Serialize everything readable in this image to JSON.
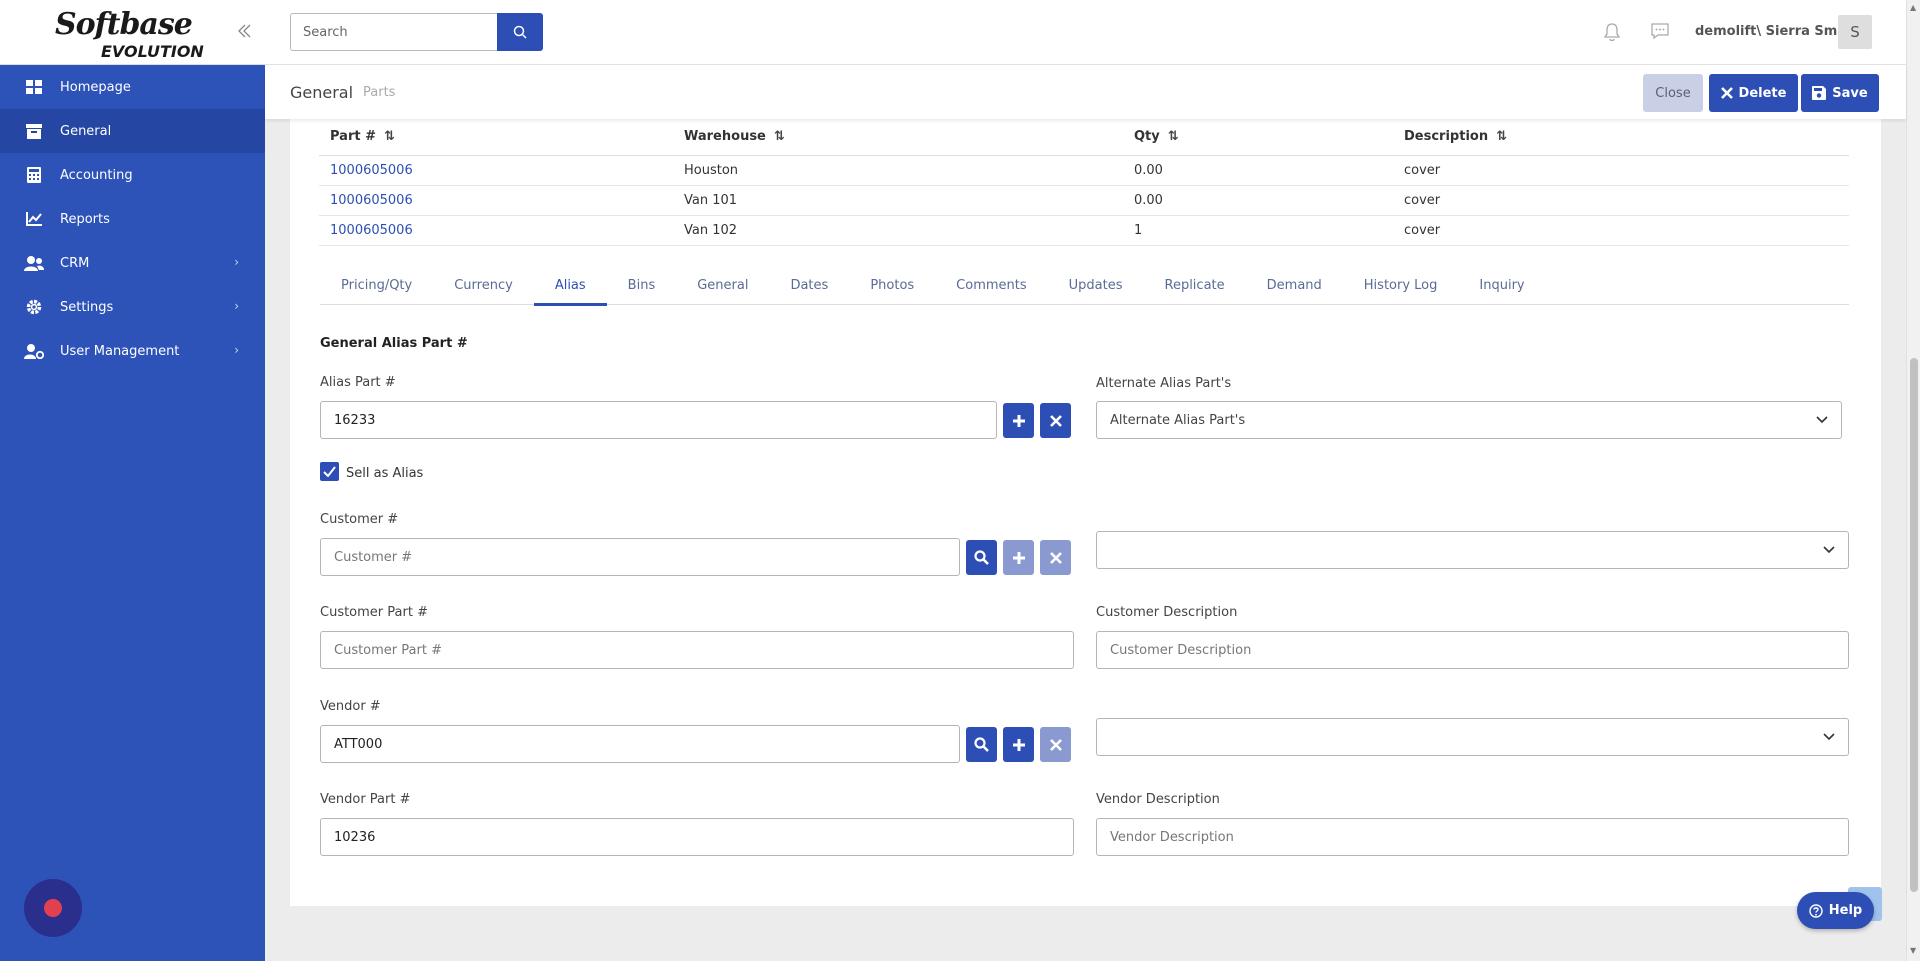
{
  "app": {
    "logo_text": "Softbase",
    "logo_sub": "EVOLUTION"
  },
  "sidebar": {
    "items": [
      {
        "label": "Homepage",
        "icon": "dashboard-icon"
      },
      {
        "label": "General",
        "icon": "archive-box-icon",
        "active": true
      },
      {
        "label": "Accounting",
        "icon": "calculator-icon"
      },
      {
        "label": "Reports",
        "icon": "chart-line-icon"
      },
      {
        "label": "CRM",
        "icon": "users-icon",
        "has_children": true
      },
      {
        "label": "Settings",
        "icon": "gear-icon",
        "has_children": true
      },
      {
        "label": "User Management",
        "icon": "user-gear-icon",
        "has_children": true
      }
    ]
  },
  "topbar": {
    "search_placeholder": "Search",
    "user_name": "demolift\\ Sierra Smith",
    "avatar_initial": "S"
  },
  "header": {
    "breadcrumb_main": "General",
    "breadcrumb_sub": "Parts",
    "close_label": "Close",
    "delete_label": "Delete",
    "save_label": "Save"
  },
  "grid": {
    "columns": [
      "Part #",
      "Warehouse",
      "Qty",
      "Description"
    ],
    "rows": [
      [
        "1000605006",
        "Houston",
        "0.00",
        "cover"
      ],
      [
        "1000605006",
        "Van 101",
        "0.00",
        "cover"
      ],
      [
        "1000605006",
        "Van 102",
        "1",
        "cover"
      ]
    ]
  },
  "tabs": [
    "Pricing/Qty",
    "Currency",
    "Alias",
    "Bins",
    "General",
    "Dates",
    "Photos",
    "Comments",
    "Updates",
    "Replicate",
    "Demand",
    "History Log",
    "Inquiry"
  ],
  "active_tab": "Alias",
  "form": {
    "section_title": "General Alias Part #",
    "alias_part_label": "Alias Part #",
    "alias_part_value": "16233",
    "alternate_alias_label": "Alternate Alias Part's",
    "alternate_alias_value": "Alternate Alias Part's",
    "sell_as_alias_label": "Sell as Alias",
    "sell_as_alias_checked": true,
    "customer_label": "Customer #",
    "customer_placeholder": "Customer #",
    "customer_select_value": "",
    "customer_part_label": "Customer Part #",
    "customer_part_placeholder": "Customer Part #",
    "customer_desc_label": "Customer Description",
    "customer_desc_placeholder": "Customer Description",
    "vendor_label": "Vendor #",
    "vendor_value": "ATT000",
    "vendor_select_value": "",
    "vendor_part_label": "Vendor Part #",
    "vendor_part_value": "10236",
    "vendor_desc_label": "Vendor Description",
    "vendor_desc_placeholder": "Vendor Description"
  },
  "help": {
    "label": "Help"
  },
  "colors": {
    "primary": "#2d4fb5",
    "sidebar": "#2d53b8",
    "sidebar_active": "#2547a3",
    "record": "#e04050"
  }
}
